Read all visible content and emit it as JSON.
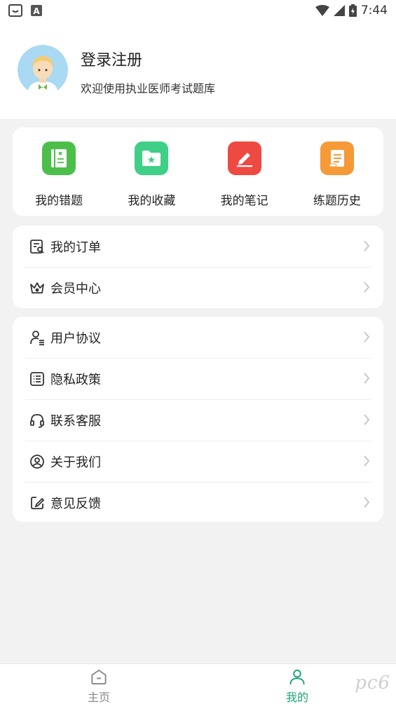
{
  "status_bar": {
    "time": "7:44"
  },
  "profile": {
    "title": "登录注册",
    "subtitle": "欢迎使用执业医师考试题库"
  },
  "quick_actions": [
    {
      "label": "我的错题",
      "icon": "wrong-questions-icon",
      "color": "#4cbf4a"
    },
    {
      "label": "我的收藏",
      "icon": "favorites-folder-icon",
      "color": "#3fcf87"
    },
    {
      "label": "我的笔记",
      "icon": "notes-pen-icon",
      "color": "#ee4a41"
    },
    {
      "label": "练题历史",
      "icon": "history-scroll-icon",
      "color": "#f59a37"
    }
  ],
  "menu_group_1": [
    {
      "label": "我的订单",
      "icon": "order-icon"
    },
    {
      "label": "会员中心",
      "icon": "crown-icon"
    }
  ],
  "menu_group_2": [
    {
      "label": "用户协议",
      "icon": "user-agreement-icon"
    },
    {
      "label": "隐私政策",
      "icon": "privacy-list-icon"
    },
    {
      "label": "联系客服",
      "icon": "headset-icon"
    },
    {
      "label": "关于我们",
      "icon": "about-user-icon"
    },
    {
      "label": "意见反馈",
      "icon": "feedback-edit-icon"
    }
  ],
  "tab_bar": [
    {
      "label": "主页",
      "icon": "home-icon",
      "active": false
    },
    {
      "label": "我的",
      "icon": "profile-icon",
      "active": true
    }
  ],
  "watermark": "pc6",
  "colors": {
    "accent": "#1fa47a",
    "background": "#f2f2f2"
  }
}
